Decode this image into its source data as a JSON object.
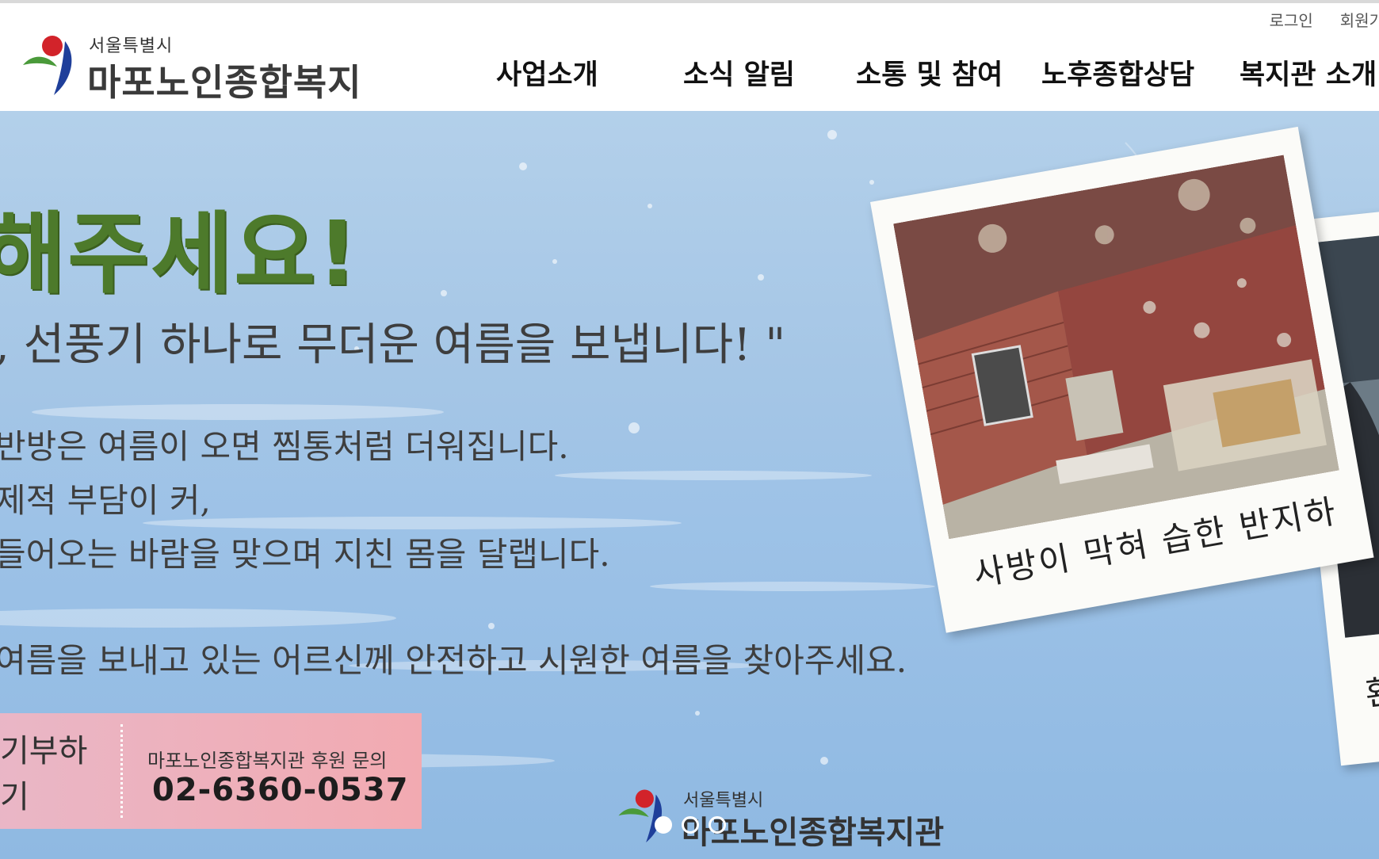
{
  "header": {
    "util": {
      "login": "로그인",
      "signup": "회원가"
    },
    "logo": {
      "city": "서울특별시",
      "name": "마포노인종합복지관"
    },
    "nav": [
      "사업소개",
      "소식 알림",
      "소통 및 참여",
      "노후종합상담",
      "복지관 소개"
    ]
  },
  "hero": {
    "headline": "해주세요!",
    "quote": ", 선풍기 하나로 무더운 여름을 보냅니다! \"",
    "body": [
      "반방은 여름이 오면 찜통처럼 더워집니다.",
      "제적 부담이 커,",
      "들어오는 바람을 맞으며 지친 몸을 달랩니다.",
      "여름을 보내고 있는 어르신께 안전하고 시원한 여름을 찾아주세요."
    ],
    "donate": {
      "button": "기부하기",
      "contact_label": "마포노인종합복지관 후원 문의",
      "phone": "02-6360-0537"
    },
    "photos": [
      {
        "caption": "사방이 막혀 습한 반지하"
      },
      {
        "caption": "환기조치"
      }
    ],
    "bottom_logo": {
      "city": "서울특별시",
      "name": "마포노인종합복지관"
    },
    "slider": {
      "count": 3,
      "active": 1
    }
  },
  "colors": {
    "headline": "#4d7a2b",
    "hero_bg": "#a5c6e6",
    "donate_bg": "#f2aab1"
  }
}
